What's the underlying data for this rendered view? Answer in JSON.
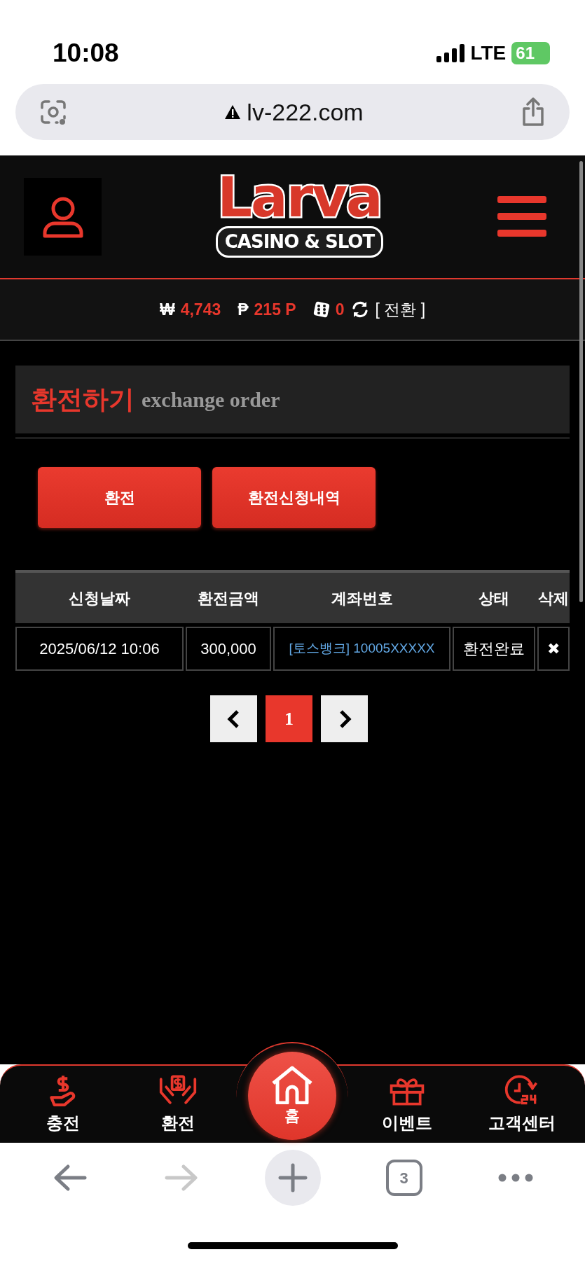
{
  "status_bar": {
    "time": "10:08",
    "network": "LTE",
    "battery": "61"
  },
  "address_bar": {
    "url": "lv-222.com"
  },
  "header": {
    "logo_title": "Larva",
    "logo_subtitle": "CASINO & SLOT"
  },
  "balance": [
    {
      "kind": "cash",
      "symbol": "₩",
      "value": "4,743"
    },
    {
      "kind": "point",
      "symbol": "₱",
      "value": "215 P"
    },
    {
      "kind": "chip",
      "value": "0"
    }
  ],
  "convert_label": "[ 전환 ]",
  "section": {
    "title": "환전하기",
    "subtitle": "exchange order"
  },
  "buttons": [
    "환전",
    "환전신청내역"
  ],
  "table": {
    "columns": [
      "신청날짜",
      "환전금액",
      "계좌번호",
      "상태",
      "삭제"
    ],
    "rows": [
      [
        "2025/06/12 10:06",
        "300,000",
        "[토스뱅크] 10005XXXXX",
        "환전완료",
        "✖"
      ]
    ]
  },
  "pagination": {
    "pages": [
      {
        "label": "1",
        "selected": true
      }
    ]
  },
  "bottom_nav": [
    {
      "kind": "charge",
      "label": "충전",
      "selected": false
    },
    {
      "kind": "exchange",
      "label": "환전",
      "selected": false
    },
    {
      "kind": "home",
      "label": "홈",
      "selected": true
    },
    {
      "kind": "event",
      "label": "이벤트",
      "selected": false
    },
    {
      "kind": "support",
      "label": "고객센터",
      "selected": false
    }
  ],
  "browser_toolbar": [
    {
      "kind": "back",
      "disabled": false
    },
    {
      "kind": "forward",
      "disabled": true
    },
    {
      "kind": "new_tab",
      "disabled": false
    },
    {
      "kind": "tabs",
      "label": "3",
      "disabled": false
    },
    {
      "kind": "more",
      "disabled": false
    }
  ]
}
